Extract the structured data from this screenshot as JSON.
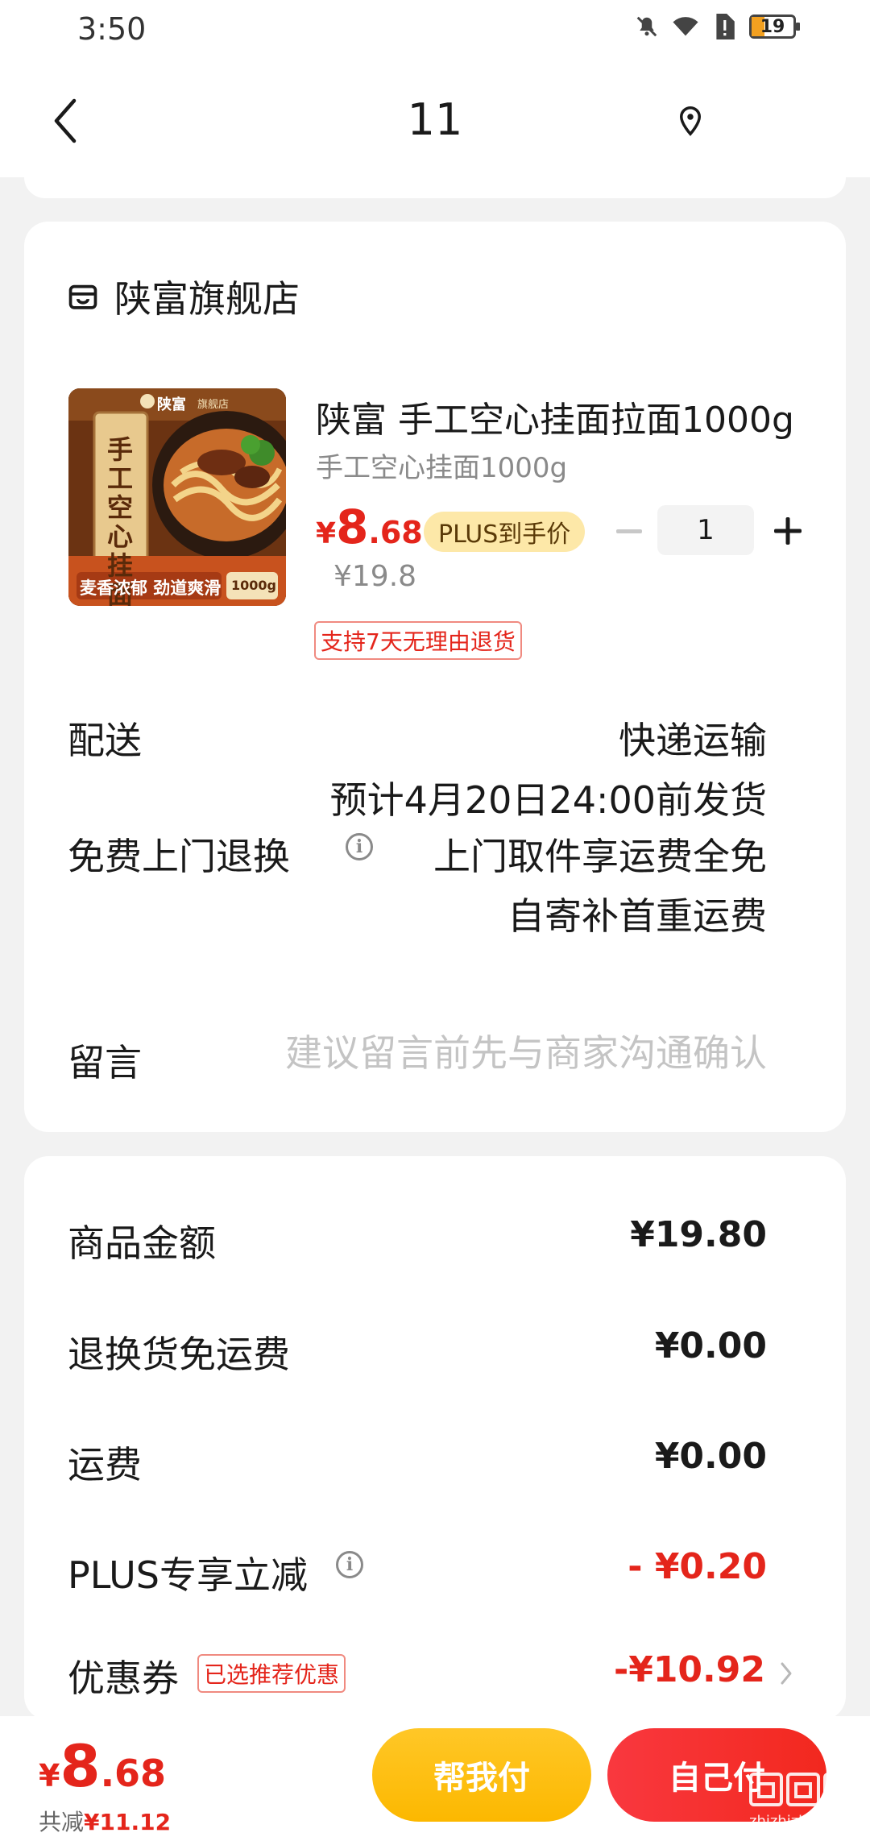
{
  "status_bar": {
    "time": "3:50",
    "battery": "19"
  },
  "nav": {
    "title": "11"
  },
  "shop": {
    "name": "陕富旗舰店"
  },
  "product": {
    "title": "陕富 手工空心挂面拉面1000g",
    "spec": "手工空心挂面1000g",
    "price_symbol": "¥",
    "price_int": "8",
    "price_dec": ".68",
    "plus_badge": "PLUS到手价",
    "original_price": "¥19.8",
    "quantity": "1",
    "return_tag": "支持7天无理由退货",
    "image_text": {
      "brand": "陕富",
      "brand_sub": "旗舰店",
      "vertical": "手工空心挂面",
      "banner": "麦香浓郁 劲道爽滑",
      "weight": "1000g"
    }
  },
  "delivery": {
    "label": "配送",
    "method": "快递运输",
    "eta": "预计4月20日24:00前发货"
  },
  "free_return": {
    "label": "免费上门退换",
    "line1": "上门取件享运费全免",
    "line2": "自寄补首重运费"
  },
  "note": {
    "label": "留言",
    "placeholder": "建议留言前先与商家沟通确认"
  },
  "costs": {
    "goods_label": "商品金额",
    "goods_value": "¥19.80",
    "return_label": "退换货免运费",
    "return_value": "¥0.00",
    "shipping_label": "运费",
    "shipping_value": "¥0.00",
    "plus_label": "PLUS专享立减",
    "plus_value": "- ¥0.20",
    "coupon_label": "优惠券",
    "coupon_tag": "已选推荐优惠",
    "coupon_value": "-¥10.92"
  },
  "bottom": {
    "total_symbol": "¥",
    "total_int": "8",
    "total_dec": ".68",
    "saved_prefix": "共减",
    "saved_value": "¥11.12",
    "help_pay": "帮我付",
    "self_pay": "自己付"
  },
  "watermark": {
    "text": "zhizhizhi.com"
  },
  "colors": {
    "accent_red": "#e4251b",
    "pay_yellow": "#fcb800",
    "plus_gold": "#fde8a8"
  }
}
